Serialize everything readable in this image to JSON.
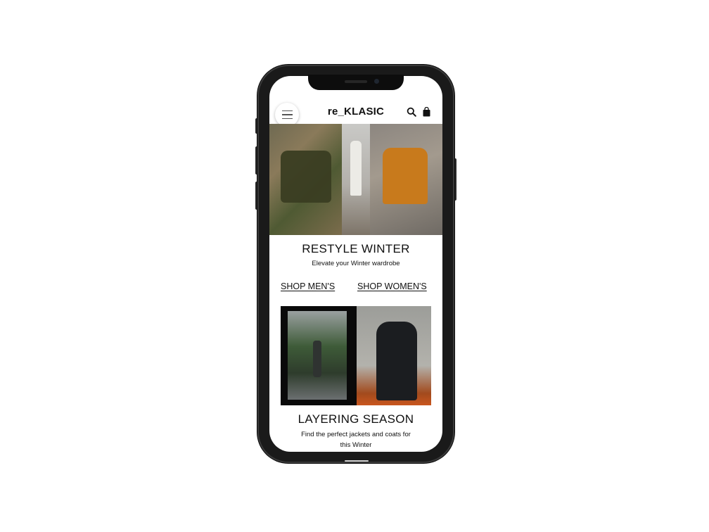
{
  "app": {
    "logo": "re_KLASIC"
  },
  "header": {
    "menu_icon": "hamburger-menu-icon",
    "search_icon": "search-icon",
    "bag_icon": "shopping-bag-icon"
  },
  "hero": {
    "title": "RESTYLE WINTER",
    "subtitle": "Elevate your Winter wardrobe"
  },
  "links": {
    "shop_mens": "SHOP MEN'S",
    "shop_womens": "SHOP WOMEN'S"
  },
  "editorial": {
    "title": "LAYERING SEASON",
    "subtitle_line1": "Find the perfect jackets and coats for",
    "subtitle_line2": "this Winter"
  },
  "colors": {
    "text": "#111111",
    "background": "#ffffff",
    "device": "#1a1a1a"
  }
}
